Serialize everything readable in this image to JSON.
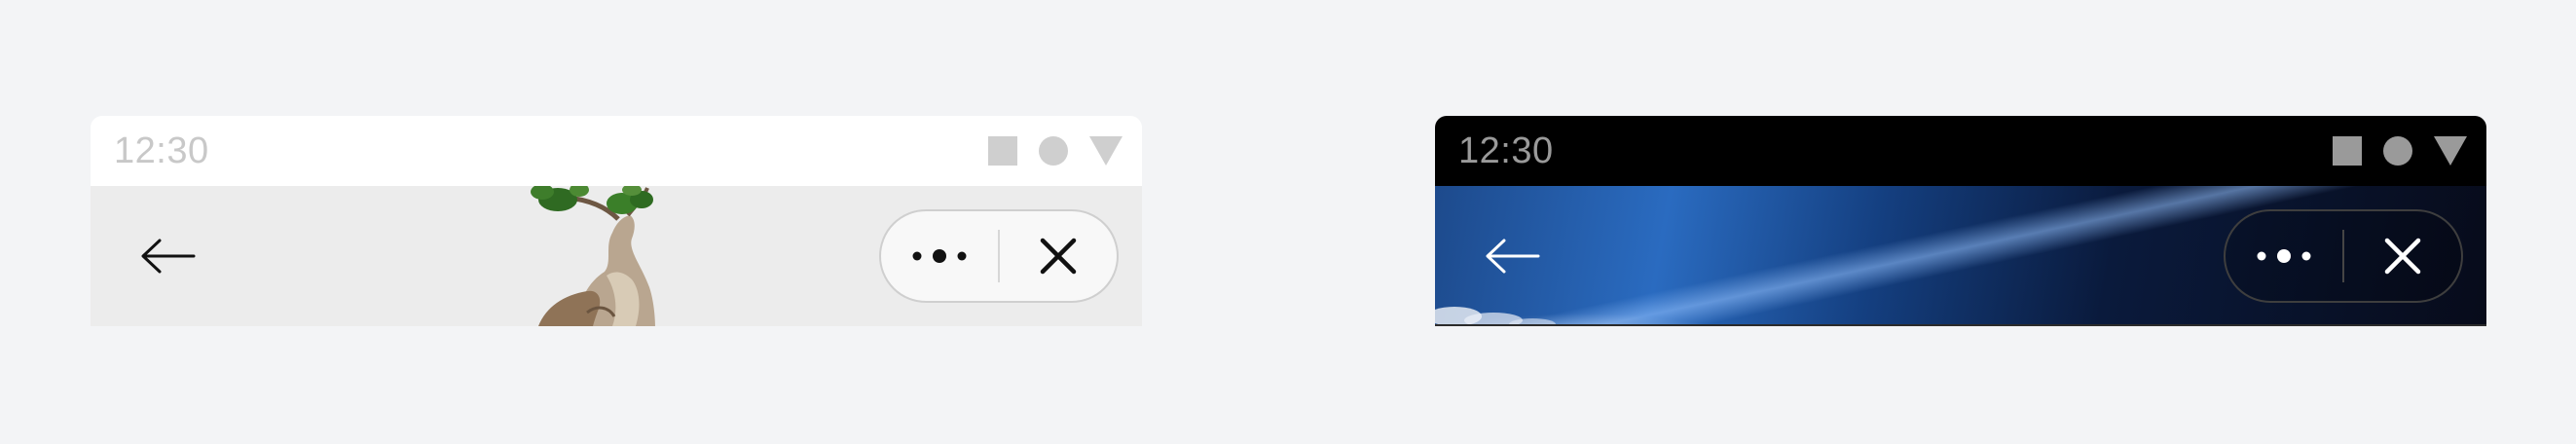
{
  "variants": {
    "light": {
      "status_bar": {
        "time": "12:30",
        "icons": [
          "square-icon",
          "circle-icon",
          "triangle-icon"
        ]
      },
      "nav_bar": {
        "back_icon": "arrow-left-icon",
        "more_icon": "more-dots-icon",
        "close_icon": "close-icon"
      },
      "colors": {
        "frame": "#ececec",
        "foreground": "#111111"
      }
    },
    "dark": {
      "status_bar": {
        "time": "12:30",
        "icons": [
          "square-icon",
          "circle-icon",
          "triangle-icon"
        ]
      },
      "nav_bar": {
        "back_icon": "arrow-left-icon",
        "more_icon": "more-dots-icon",
        "close_icon": "close-icon"
      },
      "colors": {
        "frame": "#000000",
        "foreground": "#ffffff"
      }
    }
  }
}
